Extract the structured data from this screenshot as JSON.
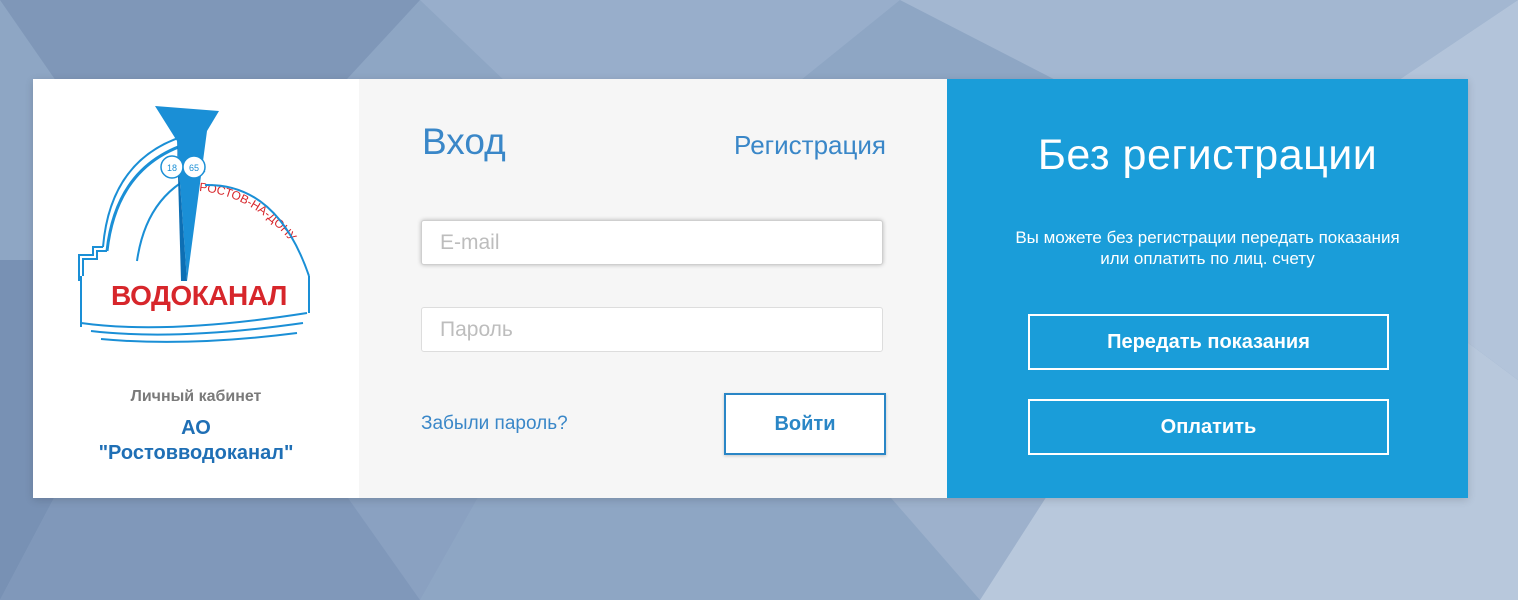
{
  "logo": {
    "years": "1865",
    "arc_text": "РОСТОВ-НА-ДОНУ",
    "wordmark": "ВОДОКАНАЛ"
  },
  "brand": {
    "cabinet_label": "Личный кабинет",
    "org_line1": "АО",
    "org_line2": "\"Ростовводоканал\""
  },
  "login": {
    "title": "Вход",
    "register_link": "Регистрация",
    "email_placeholder": "E-mail",
    "password_placeholder": "Пароль",
    "forgot_link": "Забыли пароль?",
    "submit_label": "Войти"
  },
  "guest": {
    "title": "Без регистрации",
    "description": "Вы можете без регистрации передать показания или оплатить по лиц. счету",
    "readings_button": "Передать показания",
    "pay_button": "Оплатить"
  },
  "colors": {
    "accent_blue": "#1a9dd9",
    "link_blue": "#3a87c8",
    "logo_red": "#d7262b",
    "background": "#8ea6c4"
  }
}
